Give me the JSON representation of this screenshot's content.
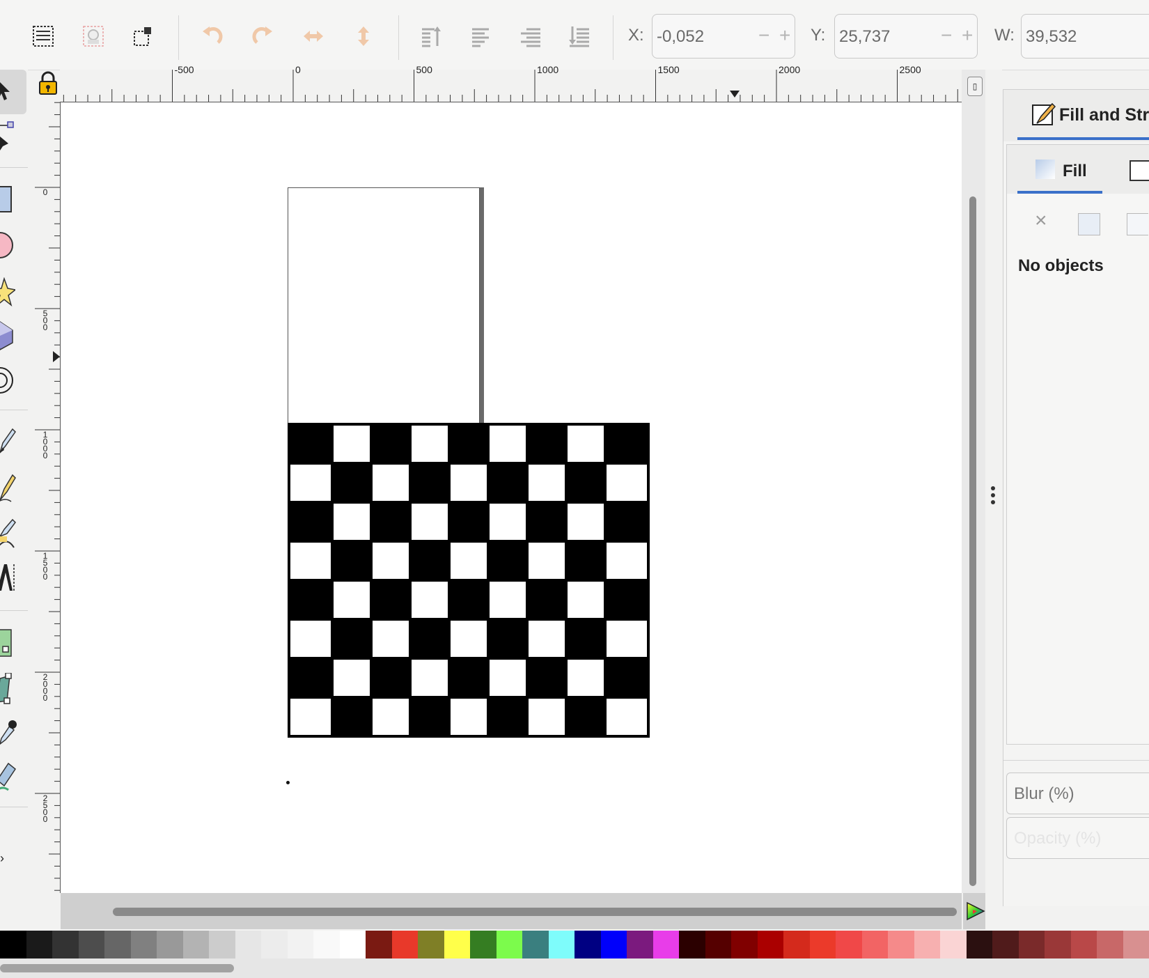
{
  "toolbar": {
    "x_label": "X:",
    "x_value": "-0,052",
    "y_label": "Y:",
    "y_value": "25,737",
    "w_label": "W:",
    "w_value": "39,532",
    "minus": "−",
    "plus": "+"
  },
  "ruler": {
    "h_labels": [
      "-500",
      "0",
      "500",
      "1000",
      "1500",
      "2000",
      "2500"
    ],
    "v_labels": [
      "0",
      "500",
      "1000",
      "1500",
      "2000",
      "2500"
    ]
  },
  "panel": {
    "title": "Fill and Stro",
    "fill_tab": "Fill",
    "no_objects": "No objects",
    "blur_label": "Blur (%)",
    "opacity_label": "Opacity (%)",
    "close_glyph": "×"
  },
  "canvas": {
    "checker_rows": 8,
    "checker_cols": 9
  },
  "palette": [
    "#000000",
    "#1a1a1a",
    "#333333",
    "#4d4d4d",
    "#666666",
    "#808080",
    "#999999",
    "#b3b3b3",
    "#cccccc",
    "#e6e6e6",
    "#ececec",
    "#f2f2f2",
    "#f9f9f9",
    "#ffffff",
    "#7a1a12",
    "#e8392a",
    "#7f7f26",
    "#ffff4a",
    "#357d22",
    "#7cfb4c",
    "#3a7f7f",
    "#7efcfb",
    "#000082",
    "#0000fb",
    "#7b1a7e",
    "#e83de9",
    "#2b0000",
    "#550000",
    "#800000",
    "#aa0000",
    "#d42a1c",
    "#eb3a2a",
    "#f04848",
    "#f26464",
    "#f58a8a",
    "#f7b0b0",
    "#fad4d4",
    "#2b1010",
    "#501b1b",
    "#7a2a2a",
    "#9a3838",
    "#b94848",
    "#c86868",
    "#d89090"
  ],
  "icons": {
    "lock": "lock-icon",
    "selector": "arrow-selector-icon",
    "rect": "rectangle-tool-icon"
  }
}
